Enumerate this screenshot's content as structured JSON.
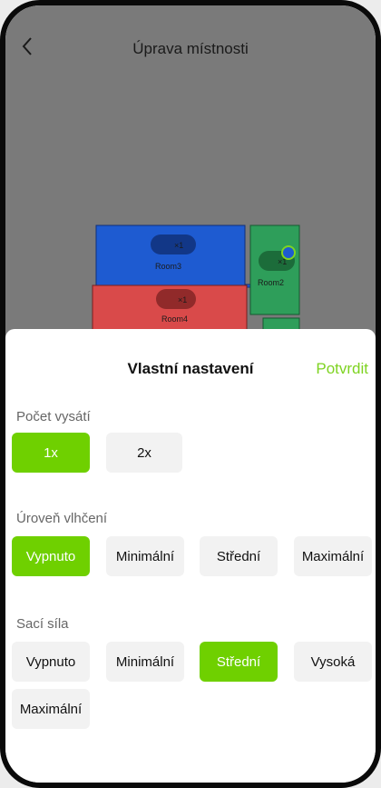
{
  "header": {
    "title": "Úprava místnosti",
    "back_icon": "chevron-left-icon"
  },
  "map": {
    "rooms": [
      {
        "name": "Room3",
        "badge": "×1",
        "color": "#1e5bd1"
      },
      {
        "name": "Room4",
        "badge": "×1",
        "color": "#d94a4a"
      },
      {
        "name": "Room2",
        "badge": "×1",
        "color": "#2e9e5a"
      }
    ]
  },
  "sheet": {
    "title": "Vlastní nastavení",
    "confirm_label": "Potvrdit",
    "accent": "#6fd000",
    "sections": [
      {
        "label": "Počet vysátí",
        "options": [
          "1x",
          "2x"
        ],
        "selected": "1x"
      },
      {
        "label": "Úroveň vlhčení",
        "options": [
          "Vypnuto",
          "Minimální",
          "Střední",
          "Maximální"
        ],
        "selected": "Vypnuto"
      },
      {
        "label": "Sací síla",
        "options": [
          "Vypnuto",
          "Minimální",
          "Střední",
          "Vysoká",
          "Maximální"
        ],
        "selected": "Střední"
      }
    ]
  }
}
